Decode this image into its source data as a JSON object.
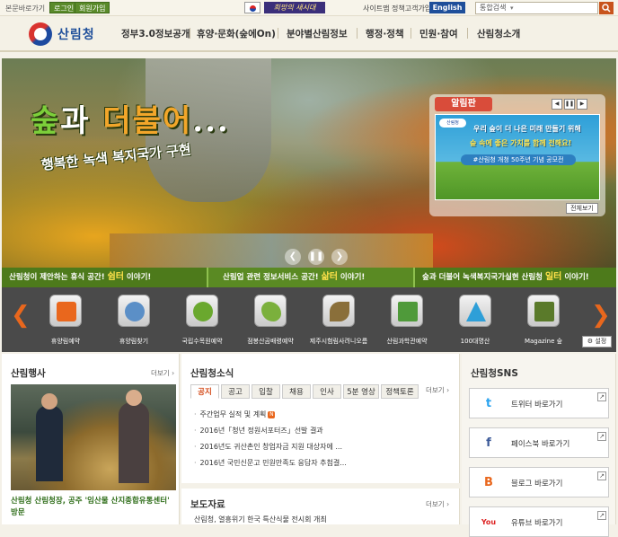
{
  "util": {
    "skip": "본문바로가기",
    "login": "로그인",
    "join": "회원가입",
    "slogan": "희망의 새시대",
    "sitemap": "사이트맵",
    "policy": "정책고객가입",
    "english": "English",
    "search_scope": "통합검색"
  },
  "header": {
    "logo": "산림청",
    "menu": [
      "정부3.0정보공개",
      "휴양·문화(숲에On)",
      "분야별산림정보",
      "행정·정책",
      "민원·참여",
      "산림청소개"
    ]
  },
  "visual": {
    "title_a": "숲",
    "title_b": "과 ",
    "title_c": "더불어",
    "title_d": "...",
    "subtitle": "행복한 녹색 복지국가 구현",
    "controls": [
      "❮",
      "❚❚",
      "❯"
    ]
  },
  "notice": {
    "title": "알림판",
    "pager": [
      "◀",
      "❚❚",
      "▶"
    ],
    "badge": "산림청",
    "line1": "우리 숲이 더 나은 미래 만들기 위해",
    "line2": "숲 속에 좋은 가치를 함께 전해요!",
    "tag": "#산림청 개청 50주년 기념 공모전",
    "more": "전체보기"
  },
  "strip": {
    "s1_pre": "산림청이 제안하는 휴식 공간! ",
    "s1_key": "쉼터",
    "s1_post": " 이야기!",
    "s2_pre": "산림업 관련 정보서비스 공간! ",
    "s2_key": "삶터",
    "s2_post": " 이야기!",
    "s3_pre": "숲과 더불어 녹색복지국가실현 산림청 ",
    "s3_key": "일터",
    "s3_post": " 이야기!"
  },
  "quick": {
    "prev": "❮",
    "next": "❯",
    "items": [
      {
        "label": "휴양림예약",
        "color": "#e9671d"
      },
      {
        "label": "휴양림찾기",
        "color": "#5b8fc7"
      },
      {
        "label": "국립수목원예약",
        "color": "#6aa82e"
      },
      {
        "label": "점봉산곰배령예약",
        "color": "#7bb03c"
      },
      {
        "label": "제주시험림사려니오름",
        "color": "#8a6f3a"
      },
      {
        "label": "산림과학관예약",
        "color": "#4f9a3a"
      },
      {
        "label": "100대명산",
        "color": "#2e9fd8"
      },
      {
        "label": "Magazine 숲",
        "color": "#5a7a2a"
      }
    ],
    "settings": "설정"
  },
  "events": {
    "title": "산림행사",
    "more": "더보기 ›",
    "caption": "산림청 산림청장, 공주 '임산물 산지종합유통센터' 방문"
  },
  "news": {
    "title": "산림청소식",
    "more": "더보기 ›",
    "tabs": [
      "공지",
      "공고",
      "입찰",
      "채용",
      "인사",
      "5분 영상",
      "정책토론"
    ],
    "items": [
      "주간업무 실적 및 계획",
      "2016년「청년 정원서포터즈」선발 결과",
      "2016년도 귀산촌인 창업자금 지원 대상자에 ...",
      "2016년 국민신문고 민원만족도 응답자 추첨결..."
    ],
    "new_badge": "N"
  },
  "press": {
    "title": "보도자료",
    "more": "더보기 ›",
    "item": "산림청, 열흥위기 한국 특산식물 전시회 개최"
  },
  "sns": {
    "title": "산림청SNS",
    "items": [
      {
        "icon": "t",
        "label": "트위터 바로가기",
        "color": "#2aa3ef"
      },
      {
        "icon": "f",
        "label": "페이스북 바로가기",
        "color": "#3b5998"
      },
      {
        "icon": "B",
        "label": "블로그 바로가기",
        "color": "#e9671d"
      },
      {
        "icon": "You",
        "label": "유튜브 바로가기",
        "color": "#d22"
      }
    ],
    "go": "↗"
  }
}
